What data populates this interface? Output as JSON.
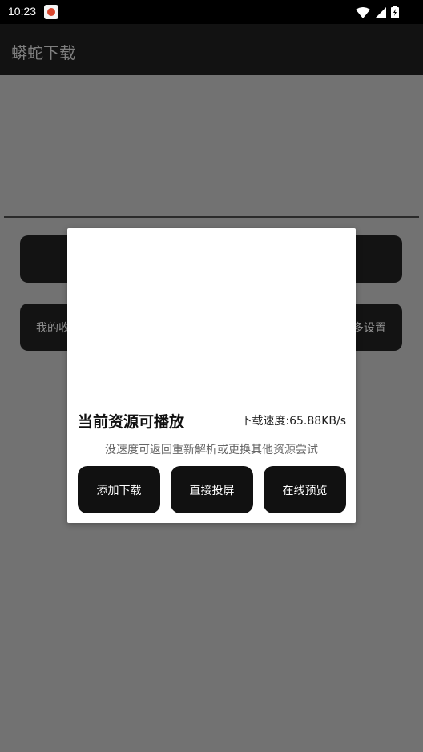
{
  "status_bar": {
    "time": "10:23"
  },
  "toolbar": {
    "title": "蟒蛇下载"
  },
  "cards": {
    "row2_left": "我的收",
    "row2_right": "多设置"
  },
  "dialog": {
    "title": "当前资源可播放",
    "speed": "下载速度:65.88KB/s",
    "tip": "没速度可返回重新解析或更换其他资源尝试",
    "buttons": {
      "add_download": "添加下载",
      "cast": "直接投屏",
      "preview": "在线预览"
    }
  },
  "colors": {
    "status_bar": "#000000",
    "toolbar": "#121212",
    "overlay_bg": "#727272",
    "card_bg": "#131313",
    "dialog_bg": "#ffffff",
    "button_bg": "#111111"
  },
  "icons": [
    "app-notification-icon",
    "wifi-icon",
    "signal-icon",
    "battery-icon"
  ]
}
